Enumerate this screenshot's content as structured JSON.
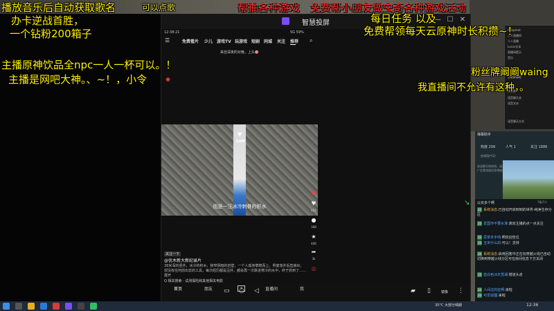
{
  "overlay": {
    "music_hint": "播放音乐后自动获取歌名",
    "can_request": "可以点歌",
    "lottery": "帮抽各种游戏",
    "free_help": "免费帮小朋友做虫奇各种游戏活动",
    "card": "办卡逆战首胜，",
    "diamond": "一个钻粉200箱子",
    "daily": "每日任务 以及",
    "free_time": "免费帮领每天云原神时长积攒~！",
    "drink": "主播原神饮品全npc一人一杯可以。！",
    "netbar": "主播是网吧大神。、~！，小令",
    "fan_badge": "粉丝牌阚阚waing",
    "not_allowed": "我直播间不允许有这种，。"
  },
  "cast": {
    "title": "智慧投屏"
  },
  "phone": {
    "status_time": "12:38:21",
    "status_right": "5G 59%",
    "tabs": [
      "免费看片",
      "少儿",
      "游戏TV",
      "玩游戏",
      "短剧",
      "同城",
      "关注",
      "推荐"
    ],
    "notice": "来自深夜的对晚，上头🎯",
    "video_caption": "而是一汪冰冷刺骨的积水",
    "video_label": "SAM",
    "side": {
      "like": "491",
      "comment": "368",
      "favorite": "406",
      "share": "3k"
    },
    "follow_tag": "关注一下",
    "author": "@优木新大新纪录片",
    "desc": "38米深的竖井，冰冷的积水，狭窄阴暗的岩壁，一个人孤身攀爬而上。男童落井后直接出，却没有任何前出去的工具，每次经历都是沿井，都会再一次跌进寒冷的水中，终于抓到了……展开",
    "search_tip": "Q 相关搜索 · 试测探险和其他相关电影",
    "bottom_nav": [
      "首页",
      "朋友",
      "+",
      "直播间",
      "我"
    ]
  },
  "danmu": {
    "title": "弹幕助手",
    "hot": "热度 208",
    "fans": "人气 1",
    "follow": "关注 1886",
    "online": "在线用户(2)",
    "messages": "欢迎聊天和热闹，请文明发言，禁止互相攻击、辱骂。发布广告等违规信息将被处理，这是官方全体通告"
  },
  "chat": {
    "all": "以买多个啊",
    "count": "7条/7人",
    "lines": [
      {
        "badge": "20",
        "name": "系统消息:",
        "text": "已自动开启到到的世界-纯净生存分区",
        "sys": true
      },
      {
        "badge": "20",
        "name": "爱国作不要水准:",
        "text": "真欢主播的点一点关注"
      },
      {
        "badge": "20",
        "name": "思茶本手响:",
        "text": "啊欢迎告位"
      },
      {
        "badge": "20",
        "name": "玉米什么的:",
        "text": "可以！支持"
      },
      {
        "badge": "20",
        "name": "系统消息:",
        "text": "启用回答中正在玩穿越火线已自动切换到穿越火线分区可在房间信息下方关闭",
        "sys": true
      },
      {
        "badge": "20",
        "name": "蓝白色冰天雪湖:",
        "text": "楼道头走"
      },
      {
        "badge": "20",
        "name": "人间过的狂啊:",
        "text": "来啦"
      },
      {
        "badge": "20",
        "name": "可爱狐狸:",
        "text": "来啦"
      }
    ]
  },
  "taskbar": {
    "weather": "30°C 大部分晴朗",
    "time": "12:36"
  },
  "colors": {
    "overlay_yellow": "#fff200",
    "overlay_red": "#ff2a2a",
    "taskbar": "#1f2a3a"
  }
}
